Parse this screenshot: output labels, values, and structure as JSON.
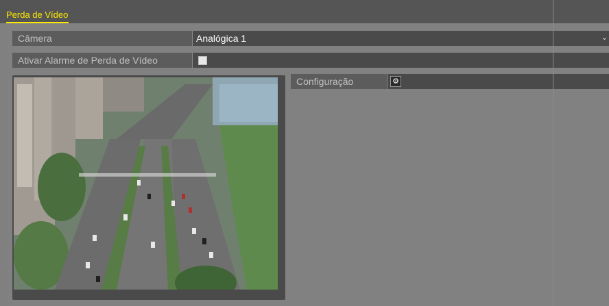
{
  "tab": {
    "title": "Perda de Vídeo"
  },
  "camera": {
    "label": "Câmera",
    "value": "Analógica 1",
    "options": [
      "Analógica 1"
    ]
  },
  "alarm": {
    "label": "Ativar Alarme de Perda de Vídeo",
    "checked": false
  },
  "settings": {
    "label": "Configuração",
    "icon": "gear-icon"
  },
  "preview": {
    "icon": "camera-preview-image"
  },
  "colors": {
    "accent": "#ffea00",
    "background": "#808080",
    "row": "#5a5a5a",
    "value_bg": "#4a4a4a",
    "label_text": "#c0c0c0",
    "value_text": "#ffffff"
  }
}
